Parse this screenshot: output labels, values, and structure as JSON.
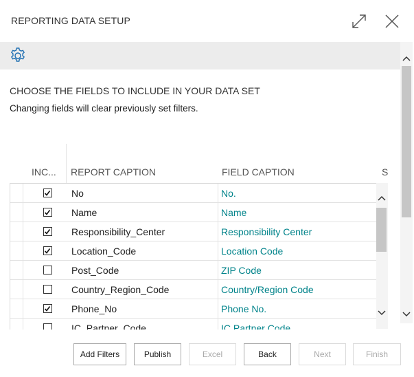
{
  "dialog": {
    "title": "REPORTING DATA SETUP"
  },
  "content": {
    "heading": "CHOOSE THE FIELDS TO INCLUDE IN YOUR DATA SET",
    "subtext": "Changing fields will clear previously set filters."
  },
  "grid": {
    "columns": {
      "include": "INC...",
      "report_caption": "REPORT CAPTION",
      "field_caption": "FIELD CAPTION",
      "extra": "S"
    },
    "rows": [
      {
        "checked": true,
        "report_caption": "No",
        "field_caption": "No."
      },
      {
        "checked": true,
        "report_caption": "Name",
        "field_caption": "Name"
      },
      {
        "checked": true,
        "report_caption": "Responsibility_Center",
        "field_caption": "Responsibility Center"
      },
      {
        "checked": true,
        "report_caption": "Location_Code",
        "field_caption": "Location Code"
      },
      {
        "checked": false,
        "report_caption": "Post_Code",
        "field_caption": "ZIP Code"
      },
      {
        "checked": false,
        "report_caption": "Country_Region_Code",
        "field_caption": "Country/Region Code"
      },
      {
        "checked": true,
        "report_caption": "Phone_No",
        "field_caption": "Phone No."
      },
      {
        "checked": false,
        "report_caption": "IC_Partner_Code",
        "field_caption": "IC Partner Code"
      }
    ]
  },
  "footer": {
    "add_filters": "Add Filters",
    "publish": "Publish",
    "excel": "Excel",
    "back": "Back",
    "next": "Next",
    "finish": "Finish"
  },
  "colors": {
    "link": "#00838a",
    "toolbar": "#ececec",
    "gear": "#1f6fb2"
  },
  "icons": [
    "expand-icon",
    "close-icon",
    "gear-icon",
    "scroll-up-icon",
    "scroll-down-icon",
    "checkbox-checked",
    "checkbox-unchecked"
  ]
}
